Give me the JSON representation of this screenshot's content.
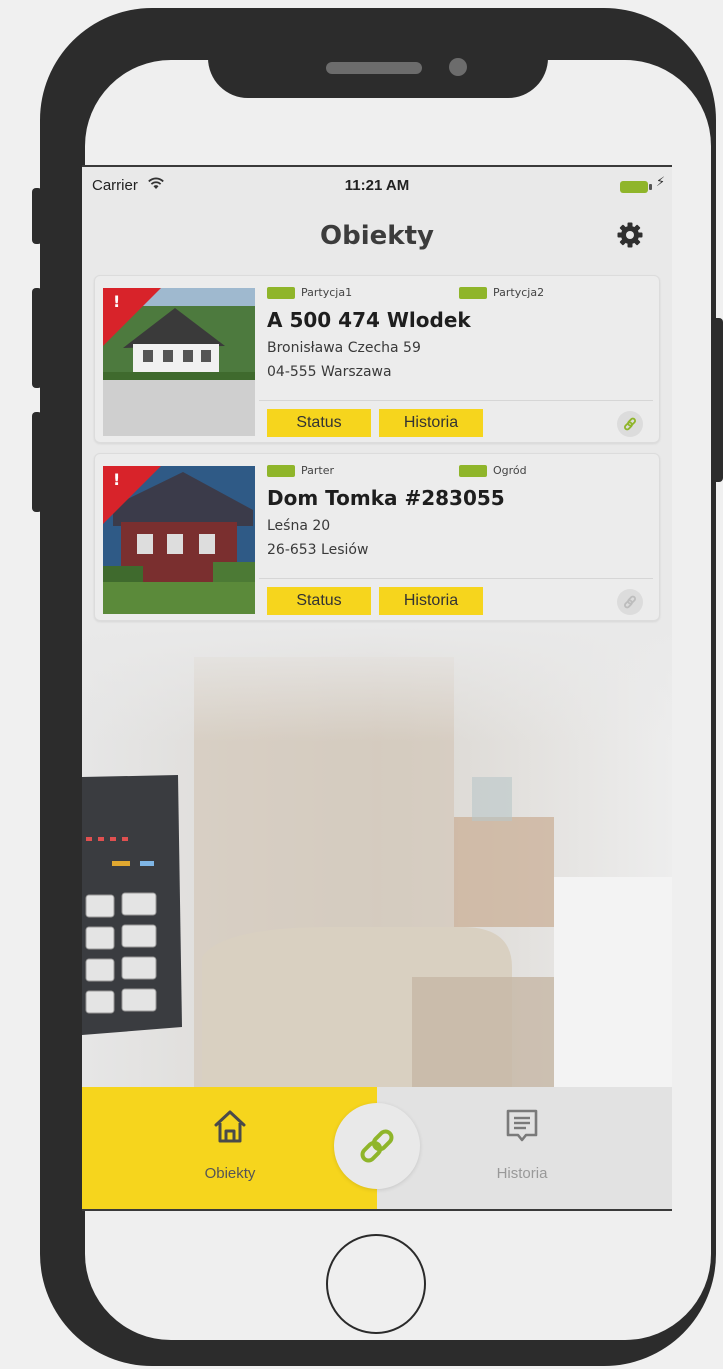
{
  "status_bar": {
    "carrier": "Carrier",
    "wifi_icon": "wifi-icon",
    "time": "11:21 AM",
    "battery_color": "#8fb52a"
  },
  "navbar": {
    "title": "Obiekty",
    "settings_icon": "gear-icon"
  },
  "objects": [
    {
      "alert": "!",
      "partitions": [
        "Partycja1",
        "Partycja2"
      ],
      "name": "A 500 474 Wlodek",
      "address_line1": "Bronisława Czecha 59",
      "address_line2": "04-555 Warszawa",
      "status_label": "Status",
      "history_label": "Historia",
      "connection_icon": "link-icon",
      "connected": true
    },
    {
      "alert": "!",
      "partitions": [
        "Parter",
        "Ogród"
      ],
      "name": "Dom Tomka #283055",
      "address_line1": "Leśna 20",
      "address_line2": "26-653 Lesiów",
      "status_label": "Status",
      "history_label": "Historia",
      "connection_icon": "link-icon",
      "connected": false
    }
  ],
  "tabbar": {
    "tab_objects_label": "Obiekty",
    "tab_objects_icon": "home-icon",
    "center_icon": "link-icon",
    "tab_history_label": "Historia",
    "tab_history_icon": "message-icon"
  },
  "colors": {
    "accent_yellow": "#f6d51d",
    "partition_green": "#8fb52a",
    "alert_red": "#d8232a"
  }
}
